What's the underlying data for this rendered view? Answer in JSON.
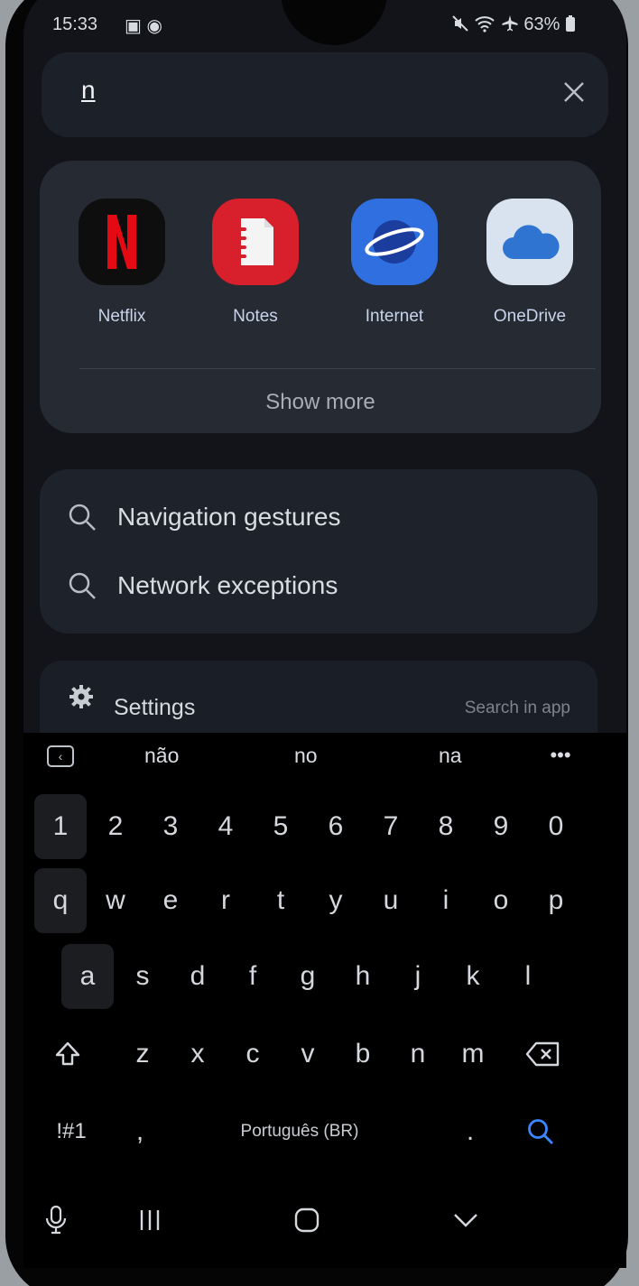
{
  "status_bar": {
    "time": "15:33",
    "left_icons": "▣ ◉",
    "right_text": "63%"
  },
  "search": {
    "query": "n"
  },
  "apps": [
    {
      "name": "Netflix",
      "icon": "netflix-icon",
      "color": "#e50914"
    },
    {
      "name": "Notes",
      "icon": "notes-icon",
      "color": "#e2242f"
    },
    {
      "name": "Internet",
      "icon": "internet-icon",
      "color": "#2f6fe0"
    },
    {
      "name": "OneDrive",
      "icon": "onedrive-icon",
      "color": "#2f74d0"
    }
  ],
  "show_more": "Show more",
  "results": [
    {
      "text": "Navigation gestures"
    },
    {
      "text": "Network exceptions"
    }
  ],
  "settings_row": {
    "label": "Settings",
    "hint": "Search in app"
  },
  "suggestions": [
    "não",
    "no",
    "na"
  ],
  "keyboard": {
    "row1": [
      "1",
      "2",
      "3",
      "4",
      "5",
      "6",
      "7",
      "8",
      "9",
      "0"
    ],
    "row2": [
      "q",
      "w",
      "e",
      "r",
      "t",
      "y",
      "u",
      "i",
      "o",
      "p"
    ],
    "row3": [
      "a",
      "s",
      "d",
      "f",
      "g",
      "h",
      "j",
      "k",
      "l"
    ],
    "row4": [
      "z",
      "x",
      "c",
      "v",
      "b",
      "n",
      "m"
    ],
    "symbols_key": "!#1",
    "comma_key": ",",
    "space_label": "Português (BR)",
    "period_key": "."
  },
  "colors": {
    "accent": "#3a86ff",
    "background": "#121419",
    "card": "#252a33"
  }
}
